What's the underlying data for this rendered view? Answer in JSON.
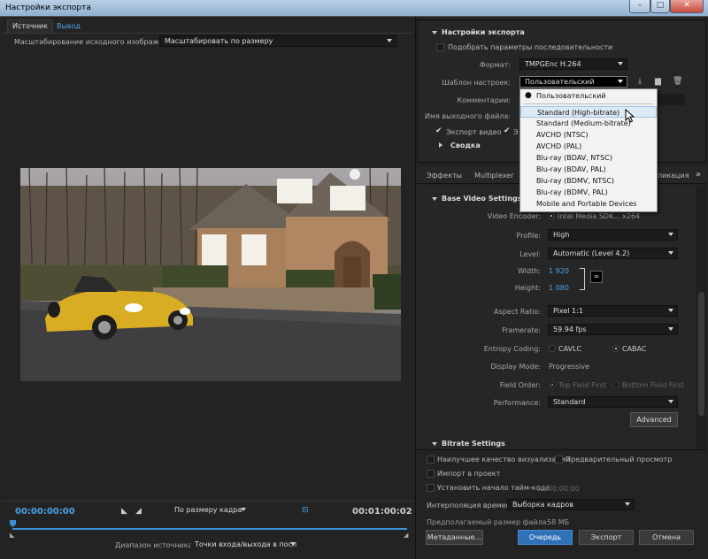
{
  "window": {
    "title": "Настройки экспорта",
    "min": "–",
    "max": "□",
    "close": "✕"
  },
  "left": {
    "tabs": [
      "Источник",
      "Вывод"
    ],
    "scaling_label": "Масштабирование исходного изображения:",
    "scaling_value": "Масштабировать по размеру",
    "timecode_start": "00:00:00:00",
    "timecode_end": "00:01:00:02",
    "fit_value": "По размеру кадра",
    "range_label": "Диапазон источника:",
    "range_value": "Точки входа/выхода в последо"
  },
  "export": {
    "section_title": "Настройки экспорта",
    "match_seq": "Подобрать параметры последовательности",
    "format_label": "Формат:",
    "format_value": "TMPGEnc H.264",
    "preset_label": "Шаблон настроек:",
    "preset_value": "Пользовательский",
    "comments_label": "Комментарии:",
    "output_name_label": "Имя выходного файла:",
    "export_video": "Экспорт видео",
    "export_audio_partial": "Э",
    "summary": "Сводка"
  },
  "preset_menu": {
    "items": [
      "Пользовательский",
      "Standard (High-bitrate)",
      "Standard (Medium-bitrate)",
      "AVCHD (NTSC)",
      "AVCHD (PAL)",
      "Blu-ray (BDAV, NTSC)",
      "Blu-ray (BDAV, PAL)",
      "Blu-ray (BDMV, NTSC)",
      "Blu-ray (BDMV, PAL)",
      "Mobile and Portable Devices"
    ]
  },
  "tabs2": {
    "effects": "Эффекты",
    "multiplexer": "Multiplexer",
    "publish_partial": "ликация",
    "more": "»"
  },
  "video": {
    "section": "Base Video Settings",
    "encoder_label": "Video Encoder:",
    "encoder_value": "Intel Media SDK...",
    "encoder_alt": "x264",
    "profile_label": "Profile:",
    "profile_value": "High",
    "level_label": "Level:",
    "level_value": "Automatic (Level 4.2)",
    "width_label": "Width:",
    "width_value": "1 920",
    "height_label": "Height:",
    "height_value": "1 080",
    "aspect_label": "Aspect Ratio:",
    "aspect_value": "Pixel 1:1",
    "framerate_label": "Framerate:",
    "framerate_value": "59.94 fps",
    "entropy_label": "Entropy Coding:",
    "entropy_a": "CAVLC",
    "entropy_b": "CABAC",
    "display_label": "Display Mode:",
    "display_value": "Progressive",
    "field_label": "Field Order:",
    "field_a": "Top Field First",
    "field_b": "Bottom Field First",
    "perf_label": "Performance:",
    "perf_value": "Standard",
    "advanced": "Advanced",
    "bitrate_section": "Bitrate Settings"
  },
  "bottom": {
    "best_quality": "Наилучшее качество визуализации",
    "preview": "Предварительный просмотр",
    "import_project": "Импорт в проект",
    "set_timecode": "Установить начало тайм-кода",
    "timecode": "00:00:00:00",
    "interp_label": "Интерполяция времени:",
    "interp_value": "Выборка кадров",
    "filesize_label": "Предполагаемый размер файла:",
    "filesize_value": "58 МБ",
    "metadata_btn": "Метаданные...",
    "queue_btn": "Очередь",
    "export_btn": "Экспорт",
    "cancel_btn": "Отмена"
  }
}
